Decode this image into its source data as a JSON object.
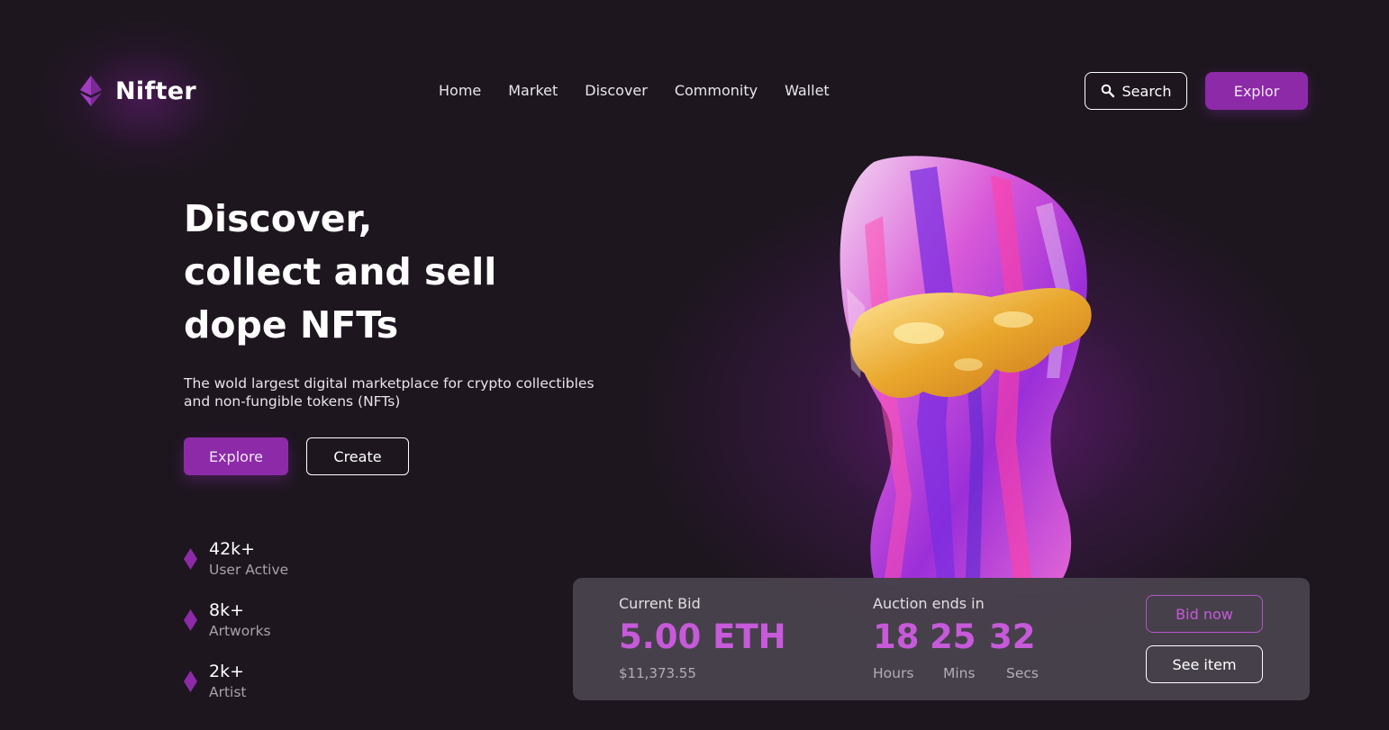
{
  "brand": {
    "name": "Nifter",
    "logo_icon": "ethereum-diamond-icon",
    "accent_color": "#8c2aa8",
    "highlight_color": "#c65ad9"
  },
  "nav": {
    "items": [
      "Home",
      "Market",
      "Discover",
      "Commonity",
      "Wallet"
    ]
  },
  "header": {
    "search_label": "Search",
    "search_icon": "search-icon",
    "explor_label": "Explor"
  },
  "hero": {
    "headline_lines": [
      "Discover,",
      "collect and sell",
      "dope NFTs"
    ],
    "subtitle": "The wold largest digital marketplace for crypto collectibles and non-fungible tokens (NFTs)",
    "explore_label": "Explore",
    "create_label": "Create"
  },
  "stats": [
    {
      "value": "42k+",
      "label": "User Active",
      "icon": "diamond-icon"
    },
    {
      "value": "8k+",
      "label": "Artworks",
      "icon": "diamond-icon"
    },
    {
      "value": "2k+",
      "label": "Artist",
      "icon": "diamond-icon"
    }
  ],
  "bid": {
    "current_bid_label": "Current Bid",
    "amount": "5.00 ETH",
    "usd": "$11,373.55",
    "auction_label": "Auction ends in",
    "timer": [
      {
        "value": "18",
        "unit": "Hours"
      },
      {
        "value": "25",
        "unit": "Mins"
      },
      {
        "value": "32",
        "unit": "Secs"
      }
    ],
    "bid_now_label": "Bid now",
    "see_item_label": "See item"
  }
}
